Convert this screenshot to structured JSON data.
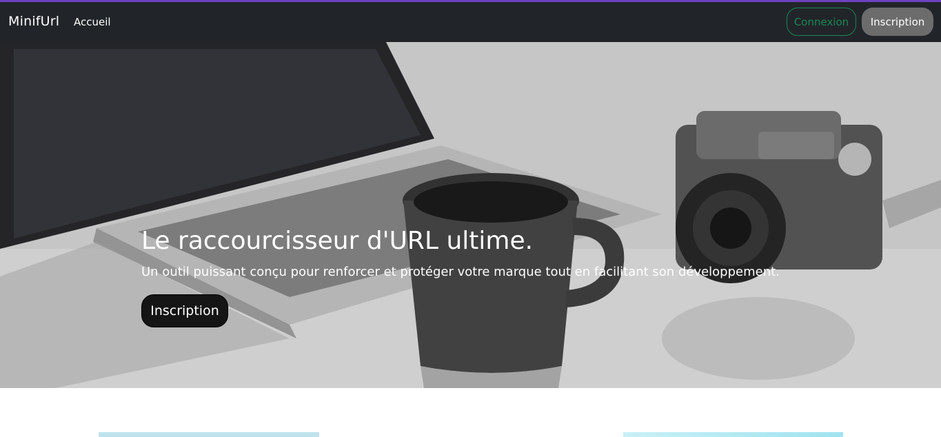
{
  "navbar": {
    "brand": "MinifUrl",
    "links": [
      "Accueil"
    ],
    "login_label": "Connexion",
    "signup_label": "Inscription"
  },
  "hero": {
    "title": "Le raccourcisseur d'URL ultime.",
    "subtitle": "Un outil puissant conçu pour renforcer et protéger votre marque tout en facilitant son développement.",
    "cta_label": "Inscription",
    "background_image": "grayscale photo of laptop, coffee mug and camera"
  },
  "colors": {
    "accent_top": "#6f42c1",
    "navbar_bg": "#212529",
    "login_green": "#198754",
    "signup_gray": "#6c6c6c"
  }
}
